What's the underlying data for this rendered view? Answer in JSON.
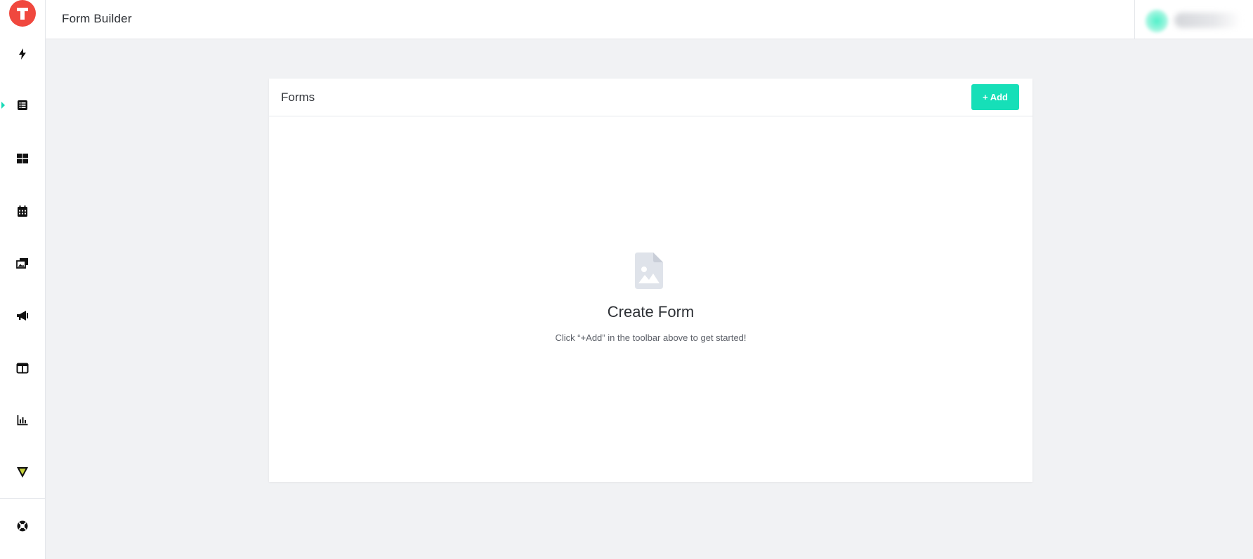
{
  "app": {
    "logo_letter": "T",
    "page_title": "Form Builder"
  },
  "sidebar": {
    "items": [
      {
        "name": "lightning-icon"
      },
      {
        "name": "list-icon",
        "active": true
      },
      {
        "name": "grid-icon"
      },
      {
        "name": "calendar-icon"
      },
      {
        "name": "images-icon"
      },
      {
        "name": "megaphone-icon"
      },
      {
        "name": "layout-icon"
      },
      {
        "name": "bar-chart-icon"
      },
      {
        "name": "triangle-logo-icon"
      },
      {
        "name": "help-lifebuoy-icon"
      }
    ],
    "active_color": "#17d9b6"
  },
  "user": {
    "avatar_icon": "avatar",
    "blurred": true
  },
  "forms_card": {
    "title": "Forms",
    "add_button_label": "+ Add",
    "empty_state": {
      "icon": "document-image-icon",
      "title": "Create Form",
      "subtitle": "Click “+Add” in the toolbar above to get started!"
    }
  },
  "colors": {
    "accent": "#16dfb8",
    "logo": "#f0483e",
    "background": "#f1f2f4"
  }
}
